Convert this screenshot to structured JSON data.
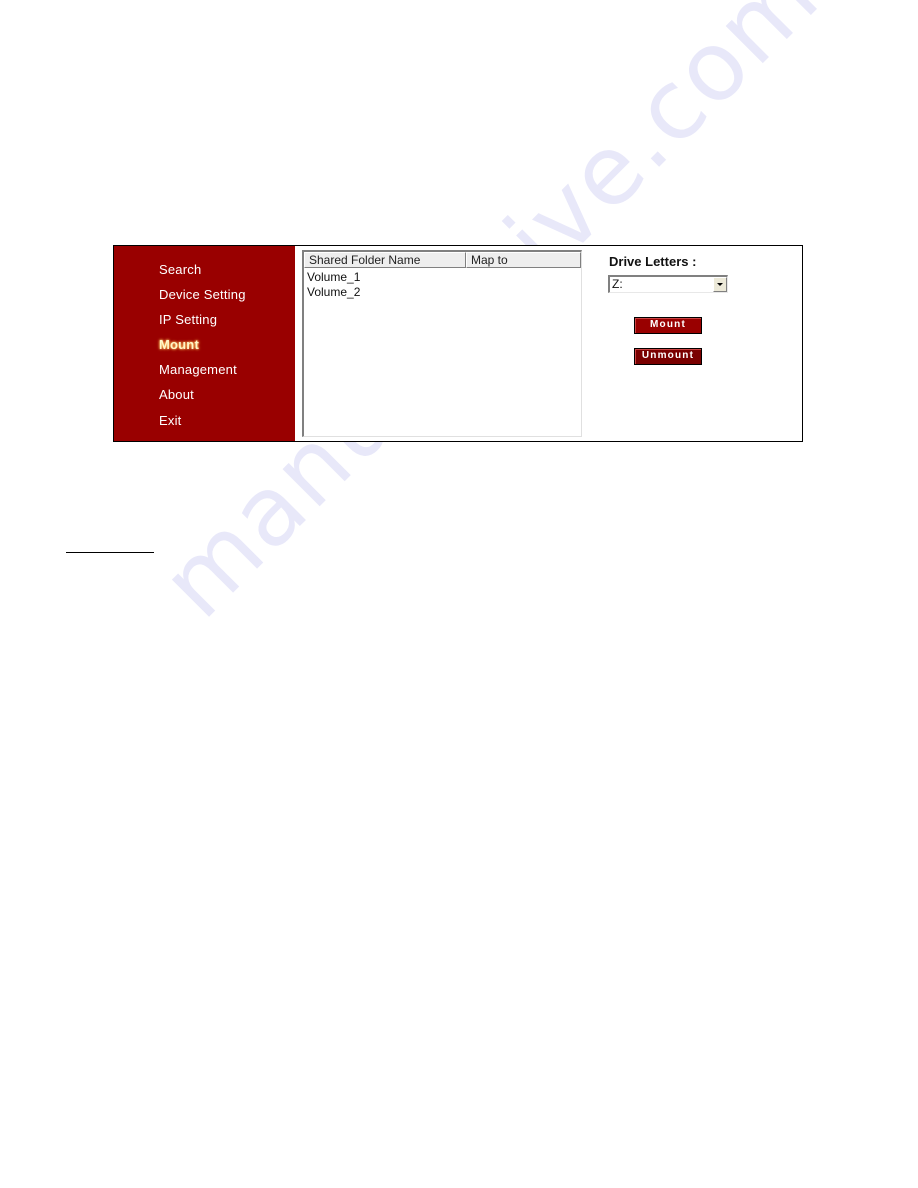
{
  "sidebar": {
    "items": [
      {
        "label": "Search",
        "active": false
      },
      {
        "label": "Device Setting",
        "active": false
      },
      {
        "label": "IP Setting",
        "active": false
      },
      {
        "label": "Mount",
        "active": true
      },
      {
        "label": "Management",
        "active": false
      },
      {
        "label": "About",
        "active": false
      },
      {
        "label": "Exit",
        "active": false
      }
    ]
  },
  "listview": {
    "columns": [
      "Shared Folder Name",
      "Map to"
    ],
    "rows": [
      {
        "name": "Volume_1",
        "map_to": ""
      },
      {
        "name": "Volume_2",
        "map_to": ""
      }
    ]
  },
  "drive": {
    "label": "Drive Letters :",
    "selected": "Z:"
  },
  "buttons": {
    "mount": "Mount",
    "unmount": "Unmount"
  },
  "watermark": "manualshive.com",
  "colors": {
    "sidebar_bg": "#990000",
    "button_bg": "#990000"
  }
}
